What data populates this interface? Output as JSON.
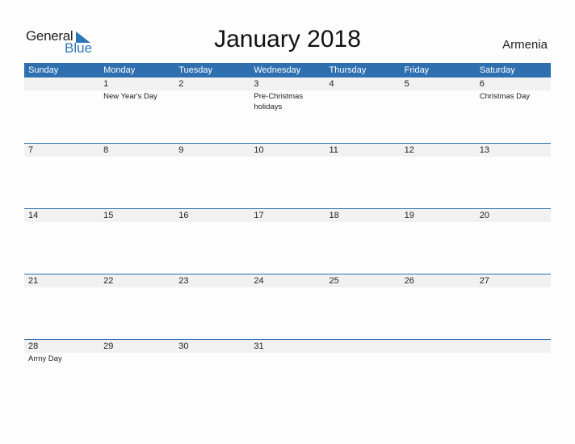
{
  "brand": {
    "general": "General",
    "blue": "Blue",
    "colors": {
      "accent": "#2e6fb0",
      "logo_blue": "#2e75b6",
      "strip": "#f1f1f1"
    }
  },
  "title": "January 2018",
  "country": "Armenia",
  "weekdays": [
    "Sunday",
    "Monday",
    "Tuesday",
    "Wednesday",
    "Thursday",
    "Friday",
    "Saturday"
  ],
  "weeks": [
    {
      "days": [
        "",
        "1",
        "2",
        "3",
        "4",
        "5",
        "6"
      ],
      "events": [
        "",
        "New Year's Day",
        "",
        "Pre-Christmas holidays",
        "",
        "",
        "Christmas Day"
      ]
    },
    {
      "days": [
        "7",
        "8",
        "9",
        "10",
        "11",
        "12",
        "13"
      ],
      "events": [
        "",
        "",
        "",
        "",
        "",
        "",
        ""
      ]
    },
    {
      "days": [
        "14",
        "15",
        "16",
        "17",
        "18",
        "19",
        "20"
      ],
      "events": [
        "",
        "",
        "",
        "",
        "",
        "",
        ""
      ]
    },
    {
      "days": [
        "21",
        "22",
        "23",
        "24",
        "25",
        "26",
        "27"
      ],
      "events": [
        "",
        "",
        "",
        "",
        "",
        "",
        ""
      ]
    },
    {
      "days": [
        "28",
        "29",
        "30",
        "31",
        "",
        "",
        ""
      ],
      "events": [
        "Army Day",
        "",
        "",
        "",
        "",
        "",
        ""
      ]
    }
  ]
}
